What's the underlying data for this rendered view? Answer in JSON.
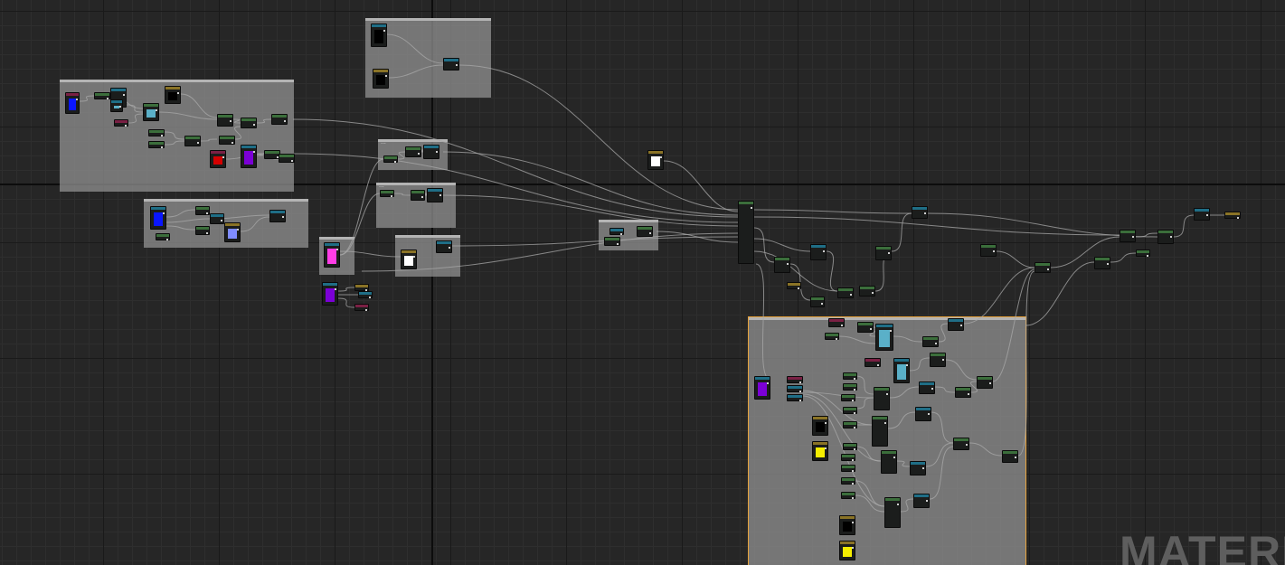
{
  "editor": {
    "watermark": "MATERI"
  },
  "colors": {
    "background": "#262626",
    "comment_fill": "#969696",
    "comment_selected_outline": "#e8a33c",
    "node_body": "#1b1d1c",
    "wire": "#a9a9a9",
    "header_scalar": "#3b6e3b",
    "header_vector": "#1f6e86",
    "header_texture": "#8a7326",
    "header_param": "#7a2044",
    "swatch_blue": "#0a16ff",
    "swatch_light_blue": "#5ab0c8",
    "swatch_red": "#d40000",
    "swatch_purple": "#7b00d6",
    "swatch_magenta": "#ff3de6",
    "swatch_white": "#ffffff",
    "swatch_yellow": "#f5ee00",
    "swatch_periwinkle": "#7f8cff"
  },
  "comment_boxes": [
    {
      "id": "upper-left",
      "title": ""
    },
    {
      "id": "top-center",
      "title": ""
    },
    {
      "id": "center-small-1",
      "title": "..."
    },
    {
      "id": "center-small-2",
      "title": "..."
    },
    {
      "id": "mid-left",
      "title": ""
    },
    {
      "id": "pink-box",
      "title": ""
    },
    {
      "id": "white-box",
      "title": ""
    },
    {
      "id": "middle-right-small",
      "title": ""
    },
    {
      "id": "main-selected",
      "title": ""
    }
  ]
}
